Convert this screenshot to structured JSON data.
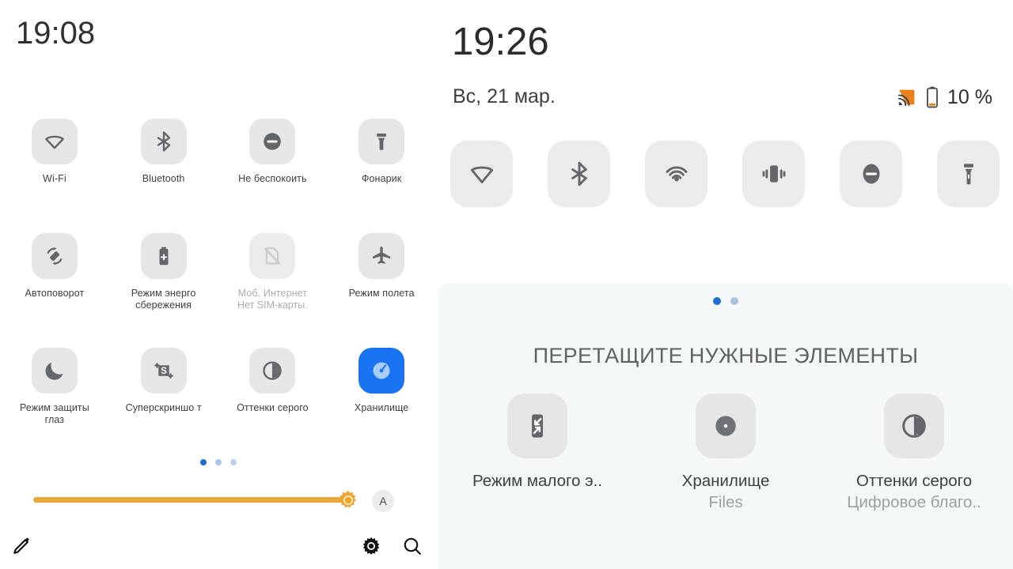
{
  "left": {
    "clock": "19:08",
    "tiles": [
      {
        "label": "Wi-Fi",
        "sub": "",
        "icon": "wifi-icon",
        "state": "off"
      },
      {
        "label": "Bluetooth",
        "sub": "",
        "icon": "bluetooth-icon",
        "state": "off"
      },
      {
        "label": "Не беспокоить",
        "sub": "",
        "icon": "do-not-disturb-icon",
        "state": "off"
      },
      {
        "label": "Фонарик",
        "sub": "",
        "icon": "flashlight-icon",
        "state": "off"
      },
      {
        "label": "Автоповорот",
        "sub": "",
        "icon": "auto-rotate-icon",
        "state": "off"
      },
      {
        "label": "Режим энерго сбережения",
        "sub": "",
        "icon": "battery-saver-icon",
        "state": "off"
      },
      {
        "label": "Моб. Интернет",
        "sub": "Нет SIM-карты.",
        "icon": "sim-off-icon",
        "state": "disabled"
      },
      {
        "label": "Режим полета",
        "sub": "",
        "icon": "airplane-icon",
        "state": "off"
      },
      {
        "label": "Режим защиты глаз",
        "sub": "",
        "icon": "eye-comfort-icon",
        "state": "off"
      },
      {
        "label": "Суперскриншо т",
        "sub": "",
        "icon": "super-screenshot-icon",
        "state": "off"
      },
      {
        "label": "Оттенки серого",
        "sub": "",
        "icon": "grayscale-icon",
        "state": "off"
      },
      {
        "label": "Хранилище",
        "sub": "",
        "icon": "storage-icon",
        "state": "on"
      }
    ],
    "page_dots": {
      "count": 3,
      "active_index": 0
    },
    "brightness": {
      "value_percent": 97,
      "track_color": "#eaa83a",
      "thumb_icon": "brightness-sun-icon",
      "auto_label": "A"
    },
    "bottom_bar": [
      {
        "name": "edit-icon",
        "label": ""
      },
      {
        "name": "settings-icon",
        "label": ""
      },
      {
        "name": "search-icon",
        "label": ""
      }
    ]
  },
  "right": {
    "clock": "19:26",
    "date": "Вс, 21 мар.",
    "status": {
      "cast_icon": "cast-icon",
      "battery_icon": "battery-icon",
      "battery_text": "10 %",
      "cast_color": "#e8821e"
    },
    "toggles": [
      {
        "icon": "wifi-icon",
        "name": "toggle-wifi"
      },
      {
        "icon": "bluetooth-icon",
        "name": "toggle-bluetooth"
      },
      {
        "icon": "hotspot-icon",
        "name": "toggle-hotspot"
      },
      {
        "icon": "vibrate-icon",
        "name": "toggle-vibrate"
      },
      {
        "icon": "do-not-disturb-icon",
        "name": "toggle-dnd"
      },
      {
        "icon": "flashlight-icon",
        "name": "toggle-flashlight"
      }
    ],
    "sheet": {
      "title": "ПЕРЕТАЩИТЕ НУЖНЫЕ ЭЛЕМЕНТЫ",
      "page_dots": {
        "count": 2,
        "active_index": 0
      },
      "items": [
        {
          "label": "Режим малого э..",
          "sub": "",
          "icon": "small-window-icon"
        },
        {
          "label": "Хранилище",
          "sub": "Files",
          "icon": "storage-disk-icon"
        },
        {
          "label": "Оттенки серого",
          "sub": "Цифровое благо..",
          "icon": "grayscale-icon"
        }
      ]
    }
  },
  "colors": {
    "accent_blue": "#1a73f0",
    "dot_active": "#1c6fd0",
    "tile_bg": "#e6e6e6",
    "brightness": "#eaa83a",
    "sheet_bg": "#f5f8f9"
  }
}
